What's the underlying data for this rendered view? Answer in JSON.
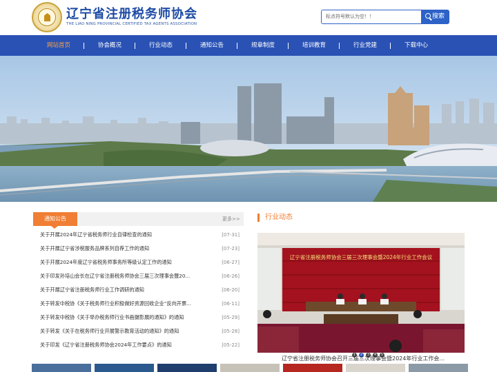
{
  "header": {
    "org_name_cn": "辽宁省注册税务师协会",
    "org_name_en": "THE LIAO NING PROVINCIAL CERTIFIED TAX AGENTS ASSOCIATION",
    "search_placeholder": "标点符号默认为空！！",
    "search_button": "搜索"
  },
  "nav": {
    "items": [
      "网站首页",
      "协会概况",
      "行业动态",
      "通知公告",
      "规章制度",
      "培训教育",
      "行业党建",
      "下载中心"
    ],
    "active": "网站首页",
    "active_color": "#f5a142",
    "bar_color": "#2a52b5"
  },
  "notices": {
    "tab_label": "通知公告",
    "more": "更多>>",
    "items": [
      {
        "title": "关于开展2024年辽宁省税务师行业自律检查的通知",
        "date": "[07-31]"
      },
      {
        "title": "关于开展辽宁省涉税服务品牌系列自荐工作的通知",
        "date": "[07-23]"
      },
      {
        "title": "关于开展2024年度辽宁省税务师事务所等级认定工作的通知",
        "date": "[06-27]"
      },
      {
        "title": "关于印发孙培山会长在辽宁省注册税务师协会三届三次理事会暨20...",
        "date": "[06-26]"
      },
      {
        "title": "关于开展辽宁省注册税务师行业工作调研的通知",
        "date": "[06-20]"
      },
      {
        "title": "关于转发中税协《关于税务师行业积极做好资源回收企业“反向开票...",
        "date": "[06-11]"
      },
      {
        "title": "关于转发中税协《关于举办税务师行业书画摄影展的通知》的通知",
        "date": "[05-29]"
      },
      {
        "title": "关于转发《关于在税务师行业开展警示教育活动的通知》的通知",
        "date": "[05-28]"
      },
      {
        "title": "关于印发《辽宁省注册税务师协会2024年工作要点》的通知",
        "date": "[05-22]"
      }
    ]
  },
  "industry": {
    "title": "行业动态",
    "caption": "辽宁省注册税务师协会召开三届三次理事会暨2024年行业工作会...",
    "banner_text": "辽宁省注册税务师协会三届三次理事会暨2024年行业工作会议",
    "slides": [
      "1",
      "2",
      "3",
      "4",
      "5"
    ],
    "active_slide": "2"
  },
  "colors": {
    "accent": "#f07e34",
    "brand": "#2a52b5"
  }
}
